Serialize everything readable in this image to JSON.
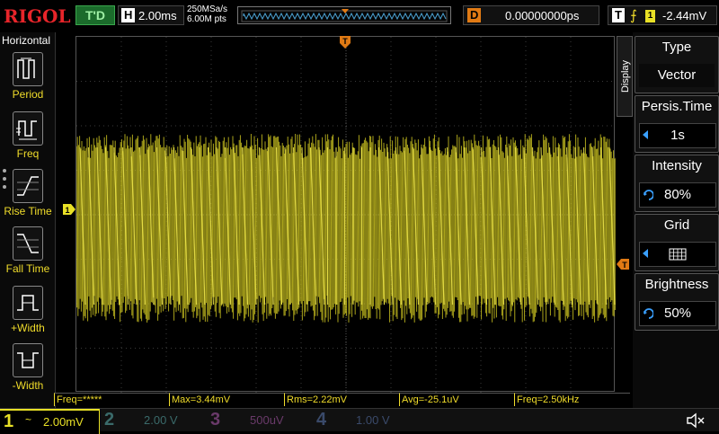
{
  "brand": "RIGOL",
  "top": {
    "trigger_status": "T'D",
    "horizontal_label": "H",
    "horizontal_scale": "2.00ms",
    "sample_rate": "250MSa/s",
    "memory_depth": "6.00M pts",
    "delay_label": "D",
    "delay_value": "0.00000000ps",
    "trigger_label": "T",
    "trigger_source": "1",
    "trigger_level": "-2.44mV"
  },
  "left_menu": {
    "title": "Horizontal",
    "items": [
      {
        "label": "Period",
        "icon": "period-icon"
      },
      {
        "label": "Freq",
        "icon": "freq-icon"
      },
      {
        "label": "Rise Time",
        "icon": "rise-time-icon"
      },
      {
        "label": "Fall Time",
        "icon": "fall-time-icon"
      },
      {
        "label": "+Width",
        "icon": "positive-width-icon"
      },
      {
        "label": "-Width",
        "icon": "negative-width-icon"
      }
    ]
  },
  "right_menu": {
    "tab": "Display",
    "items": [
      {
        "title": "Type",
        "value": "Vector"
      },
      {
        "title": "Persis.Time",
        "value": "1s"
      },
      {
        "title": "Intensity",
        "value": "80%"
      },
      {
        "title": "Grid",
        "value": ""
      },
      {
        "title": "Brightness",
        "value": "50%"
      }
    ]
  },
  "markers": {
    "trigger_position": "T",
    "ch1": "1",
    "trigger_level": "T"
  },
  "measurements": [
    {
      "text": "Freq=*****"
    },
    {
      "text": "Max=3.44mV"
    },
    {
      "text": "Rms=2.22mV"
    },
    {
      "text": "Avg=-25.1uV"
    },
    {
      "text": "Freq=2.50kHz"
    }
  ],
  "channels": [
    {
      "num": "1",
      "coupling": "~",
      "scale": "2.00mV"
    },
    {
      "num": "2",
      "coupling": "",
      "scale": "2.00 V"
    },
    {
      "num": "3",
      "coupling": "",
      "scale": "500uV"
    },
    {
      "num": "4",
      "coupling": "",
      "scale": "1.00 V"
    }
  ],
  "colors": {
    "ch1": "#e8e026",
    "trace": "#c8c020",
    "trigger": "#e07a14",
    "brand": "#e8252a"
  }
}
